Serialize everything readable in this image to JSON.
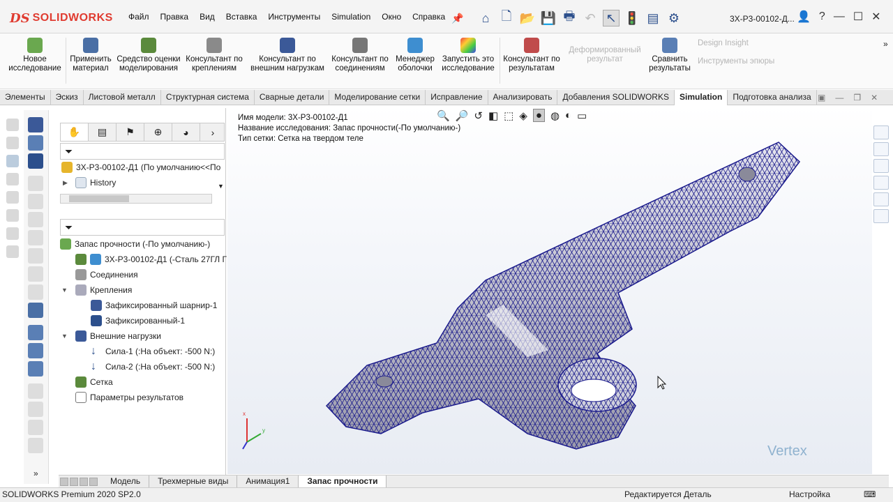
{
  "app": {
    "brand": "SOLIDWORKS",
    "doc_title": "3Х-Р3-00102-Д..."
  },
  "menu": [
    "Файл",
    "Правка",
    "Вид",
    "Вставка",
    "Инструменты",
    "Simulation",
    "Окно",
    "Справка"
  ],
  "ribbon": {
    "new_study": "Новое исследование",
    "apply_material": "Применить материал",
    "model_eval": "Средство оценки моделирования",
    "fixtures_advisor": "Консультант по креплениям",
    "loads_advisor": "Консультант по внешним нагрузкам",
    "connections_advisor": "Консультант по соединениям",
    "shell_manager": "Менеджер оболочки",
    "run_study": "Запустить это исследование",
    "results_advisor": "Консультант по результатам",
    "deformed_result": "Деформированный результат",
    "compare_results": "Сравнить результаты",
    "design_insight": "Design Insight",
    "plot_tools": "Инструменты эпюры"
  },
  "tabs": [
    "Элементы",
    "Эскиз",
    "Листовой металл",
    "Структурная система",
    "Сварные детали",
    "Моделирование сетки",
    "Исправление",
    "Анализировать",
    "Добавления SOLIDWORKS",
    "Simulation",
    "Подготовка анализа"
  ],
  "active_tab": "Simulation",
  "feature_tree": {
    "part": "3Х-Р3-00102-Д1  (По умолчанию<<По",
    "history": "History"
  },
  "study_tree": {
    "study": "Запас прочности (-По умолчанию-)",
    "body": "3Х-Р3-00102-Д1 (-Сталь 27ГЛ Г",
    "connections": "Соединения",
    "fixtures": "Крепления",
    "fixed_hinge": "Зафиксированный шарнир-1",
    "fixed": "Зафиксированный-1",
    "external_loads": "Внешние нагрузки",
    "force1": "Сила-1 (:На объект: -500 N:)",
    "force2": "Сила-2 (:На объект: -500 N:)",
    "mesh": "Сетка",
    "result_options": "Параметры результатов"
  },
  "info": {
    "model_name": "Имя модели: 3Х-Р3-00102-Д1",
    "study_name": "Название исследования: Запас прочности(-По умолчанию-)",
    "mesh_type": "Тип сетки: Сетка на твердом теле"
  },
  "bottom_tabs": [
    "Модель",
    "Трехмерные виды",
    "Анимация1",
    "Запас прочности"
  ],
  "status": {
    "edition": "SOLIDWORKS Premium 2020 SP2.0",
    "editing": "Редактируется Деталь",
    "settings": "Настройка"
  },
  "triad": {
    "x": "x",
    "y": "y"
  },
  "watermark": "Vertex",
  "colors": {
    "brand": "#e03c31",
    "mesh": "#1a1a8c",
    "accent": "#2c4f8c"
  }
}
